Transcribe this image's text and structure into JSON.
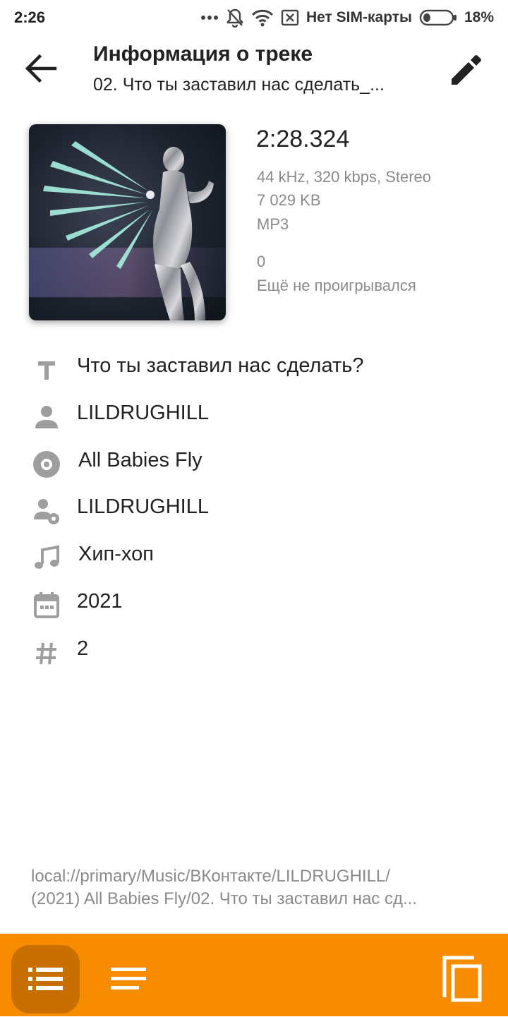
{
  "status_bar": {
    "time": "2:26",
    "carrier": "Нет SIM-карты",
    "battery": "18%",
    "icons": [
      "more-dots-icon",
      "bell-off-icon",
      "wifi-icon",
      "no-sim-icon",
      "battery-icon"
    ]
  },
  "header": {
    "title": "Информация о треке",
    "subtitle": "02. Что ты заставил нас сделать_...",
    "back_icon": "arrow-left-icon",
    "edit_icon": "pencil-icon"
  },
  "track": {
    "duration": "2:28.324",
    "format_info": "44 kHz, 320 kbps, Stereo",
    "size": "7 029 KB",
    "codec": "MP3",
    "play_count": "0",
    "last_played": "Ещё не проигрывался"
  },
  "fields": [
    {
      "icon": "title-icon",
      "value": "Что ты заставил нас сделать?"
    },
    {
      "icon": "artist-icon",
      "value": "LILDRUGHILL"
    },
    {
      "icon": "album-icon",
      "value": "All Babies Fly"
    },
    {
      "icon": "album-artist-icon",
      "value": "LILDRUGHILL"
    },
    {
      "icon": "genre-icon",
      "value": "Хип-хоп"
    },
    {
      "icon": "calendar-icon",
      "value": "2021"
    },
    {
      "icon": "track-number-icon",
      "value": "2"
    }
  ],
  "path": {
    "line1": "local://primary/Music/ВКонтакте/LILDRUGHILL/",
    "line2": "(2021) All Babies Fly/02. Что ты заставил нас сд..."
  },
  "colors": {
    "accent": "#f78c00",
    "accent_dark": "#c86f00",
    "icon_gray": "#9e9e9e",
    "secondary_text": "#8a8a8a"
  }
}
